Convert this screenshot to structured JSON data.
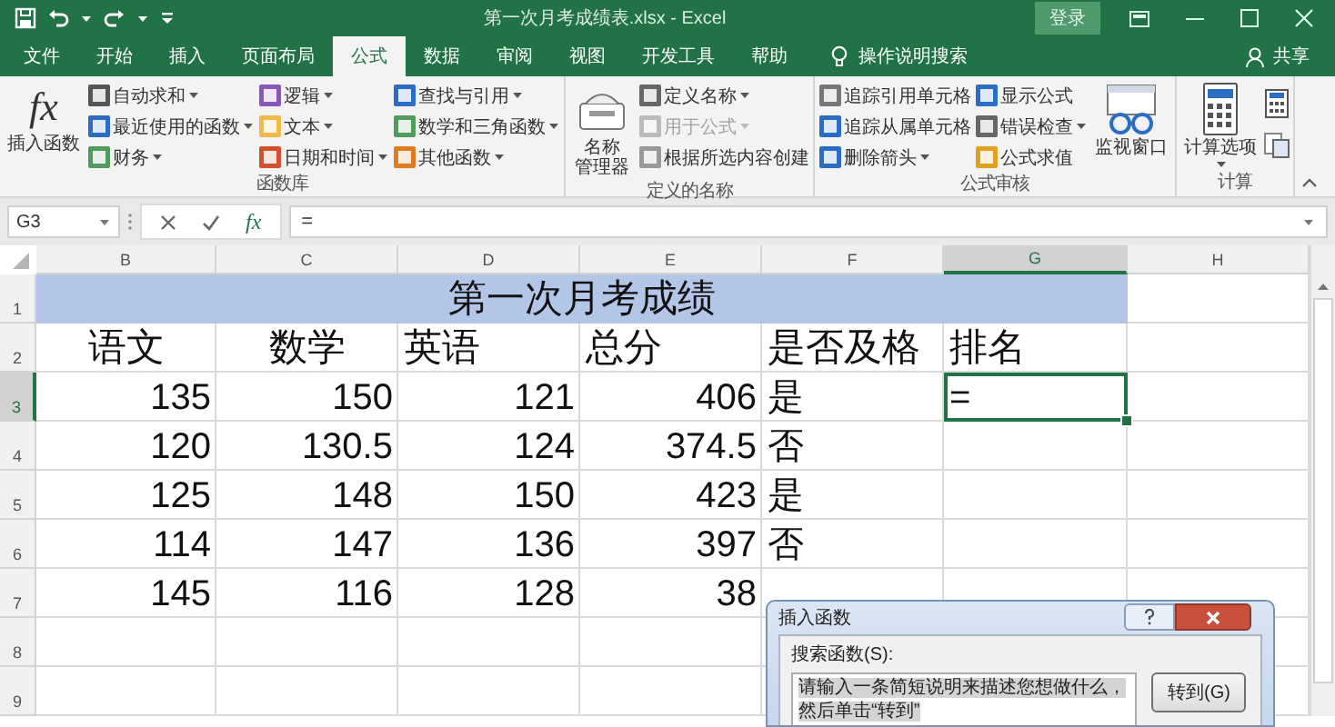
{
  "title_bar": {
    "title": "第一次月考成绩表.xlsx - Excel",
    "sign_in": "登录"
  },
  "tabs": [
    {
      "label": "文件",
      "selected": false
    },
    {
      "label": "开始",
      "selected": false
    },
    {
      "label": "插入",
      "selected": false
    },
    {
      "label": "页面布局",
      "selected": false
    },
    {
      "label": "公式",
      "selected": true
    },
    {
      "label": "数据",
      "selected": false
    },
    {
      "label": "审阅",
      "selected": false
    },
    {
      "label": "视图",
      "selected": false
    },
    {
      "label": "开发工具",
      "selected": false
    },
    {
      "label": "帮助",
      "selected": false
    }
  ],
  "tell_me": "操作说明搜索",
  "share": "共享",
  "ribbon": {
    "groups": [
      {
        "label": "函数库",
        "columns": [
          {
            "kind": "large",
            "lines": [
              "插入函数"
            ],
            "icon_text": "fx",
            "dropdown": false
          },
          {
            "kind": "small",
            "items": [
              {
                "label": "自动求和",
                "dropdown": true,
                "disabled": false
              },
              {
                "label": "最近使用的函数",
                "dropdown": true,
                "disabled": false
              },
              {
                "label": "财务",
                "dropdown": true,
                "disabled": false
              }
            ]
          },
          {
            "kind": "small",
            "items": [
              {
                "label": "逻辑",
                "dropdown": true,
                "disabled": false
              },
              {
                "label": "文本",
                "dropdown": true,
                "disabled": false
              },
              {
                "label": "日期和时间",
                "dropdown": true,
                "disabled": false
              }
            ]
          },
          {
            "kind": "small",
            "items": [
              {
                "label": "查找与引用",
                "dropdown": true,
                "disabled": false
              },
              {
                "label": "数学和三角函数",
                "dropdown": true,
                "disabled": false
              },
              {
                "label": "其他函数",
                "dropdown": true,
                "disabled": false
              }
            ]
          }
        ]
      },
      {
        "label": "定义的名称",
        "columns": [
          {
            "kind": "large",
            "lines": [
              "名称",
              "管理器"
            ],
            "dropdown": false
          },
          {
            "kind": "small",
            "items": [
              {
                "label": "定义名称",
                "dropdown": true,
                "disabled": false
              },
              {
                "label": "用于公式",
                "dropdown": true,
                "disabled": true
              },
              {
                "label": "根据所选内容创建",
                "dropdown": false,
                "disabled": false
              }
            ]
          }
        ]
      },
      {
        "label": "公式审核",
        "columns": [
          {
            "kind": "small",
            "items": [
              {
                "label": "追踪引用单元格",
                "dropdown": false,
                "disabled": false
              },
              {
                "label": "追踪从属单元格",
                "dropdown": false,
                "disabled": false
              },
              {
                "label": "删除箭头",
                "dropdown": true,
                "disabled": false
              }
            ]
          },
          {
            "kind": "small",
            "items": [
              {
                "label": "显示公式",
                "dropdown": false,
                "disabled": false
              },
              {
                "label": "错误检查",
                "dropdown": true,
                "disabled": false
              },
              {
                "label": "公式求值",
                "dropdown": false,
                "disabled": false
              }
            ]
          },
          {
            "kind": "large",
            "lines": [
              "监视窗口"
            ],
            "dropdown": false
          }
        ]
      },
      {
        "label": "计算",
        "columns": [
          {
            "kind": "large",
            "lines": [
              "计算选项"
            ],
            "dropdown": true
          },
          {
            "kind": "icon_stack"
          }
        ]
      }
    ]
  },
  "formula_bar": {
    "name_box": "G3",
    "fx": "fx",
    "formula": "="
  },
  "sheet": {
    "columns": [
      {
        "label": "B",
        "selected": false
      },
      {
        "label": "C",
        "selected": false
      },
      {
        "label": "D",
        "selected": false
      },
      {
        "label": "E",
        "selected": false
      },
      {
        "label": "F",
        "selected": false
      },
      {
        "label": "G",
        "selected": true
      },
      {
        "label": "H",
        "selected": false
      }
    ],
    "rows": [
      {
        "label": "1",
        "selected": false,
        "kind": "title",
        "title": "第一次月考成绩"
      },
      {
        "label": "2",
        "selected": false,
        "kind": "header",
        "cells": [
          "语文",
          "数学",
          "英语",
          "总分",
          "是否及格",
          "排名"
        ]
      },
      {
        "label": "3",
        "selected": true,
        "kind": "data",
        "cells": [
          "135",
          "150",
          "121",
          "406",
          "是",
          "="
        ]
      },
      {
        "label": "4",
        "selected": false,
        "kind": "data",
        "cells": [
          "120",
          "130.5",
          "124",
          "374.5",
          "否"
        ]
      },
      {
        "label": "5",
        "selected": false,
        "kind": "data",
        "cells": [
          "125",
          "148",
          "150",
          "423",
          "是"
        ]
      },
      {
        "label": "6",
        "selected": false,
        "kind": "data",
        "cells": [
          "114",
          "147",
          "136",
          "397",
          "否"
        ]
      },
      {
        "label": "7",
        "selected": false,
        "kind": "data",
        "cells": [
          "145",
          "116",
          "128",
          "38"
        ]
      },
      {
        "label": "8",
        "selected": false,
        "kind": "empty"
      },
      {
        "label": "9",
        "selected": false,
        "kind": "empty"
      }
    ]
  },
  "dialog": {
    "title": "插入函数",
    "search_label": "搜索函数(S):",
    "search_value": "请输入一条简短说明来描述您想做什么，然后单击“转到”",
    "value_selected": true,
    "go_button": "转到(G)"
  }
}
